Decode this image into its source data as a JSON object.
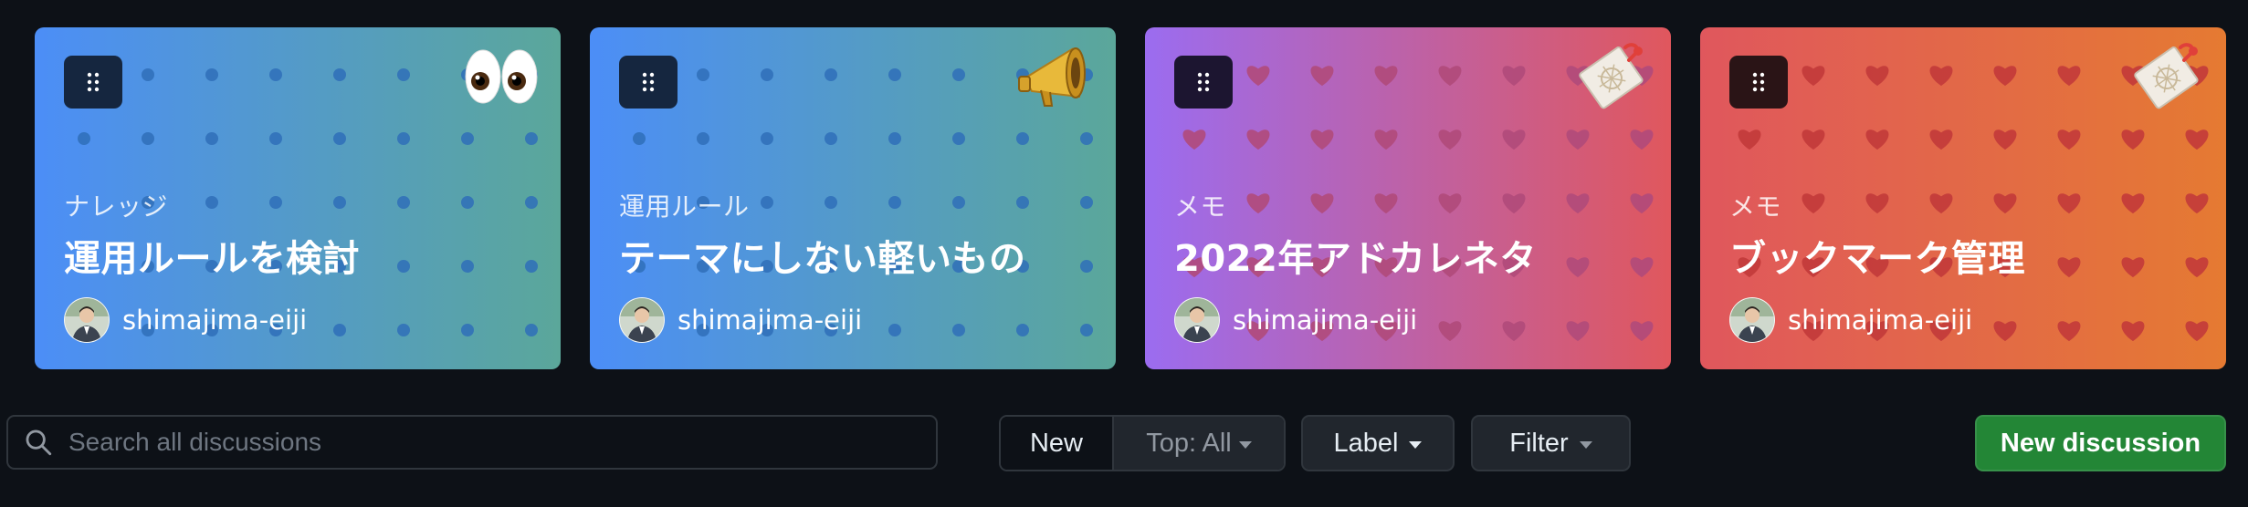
{
  "cards": [
    {
      "category": "ナレッジ",
      "title": "運用ルールを検討",
      "author": "shimajima-eiji",
      "emoji_icon": "eyes-icon",
      "pattern": "dots",
      "gradient": [
        "#4c8ef7",
        "#5ba79a"
      ],
      "pattern_color": "#2f6fb8",
      "handle_bg": "#15263f"
    },
    {
      "category": "運用ルール",
      "title": "テーマにしない軽いもの",
      "author": "shimajima-eiji",
      "emoji_icon": "megaphone-icon",
      "pattern": "dots",
      "gradient": [
        "#4c8ef7",
        "#5ba79a"
      ],
      "pattern_color": "#2f6fb8",
      "handle_bg": "#15263f"
    },
    {
      "category": "メモ",
      "title": "2022年アドカレネタ",
      "author": "shimajima-eiji",
      "emoji_icon": "memo-icon",
      "pattern": "hearts",
      "gradient": [
        "#9b6cf0",
        "#e0575d"
      ],
      "pattern_color": "#b04a7a",
      "handle_bg": "#1c1530"
    },
    {
      "category": "メモ",
      "title": "ブックマーク管理",
      "author": "shimajima-eiji",
      "emoji_icon": "memo-icon",
      "pattern": "hearts",
      "gradient": [
        "#e0575d",
        "#e57a32"
      ],
      "pattern_color": "#c23a3a",
      "handle_bg": "#2a1416"
    }
  ],
  "search": {
    "placeholder": "Search all discussions"
  },
  "sort": {
    "new_label": "New",
    "top_label": "Top: All"
  },
  "label_button": "Label",
  "filter_button": "Filter",
  "new_discussion_button": "New discussion"
}
